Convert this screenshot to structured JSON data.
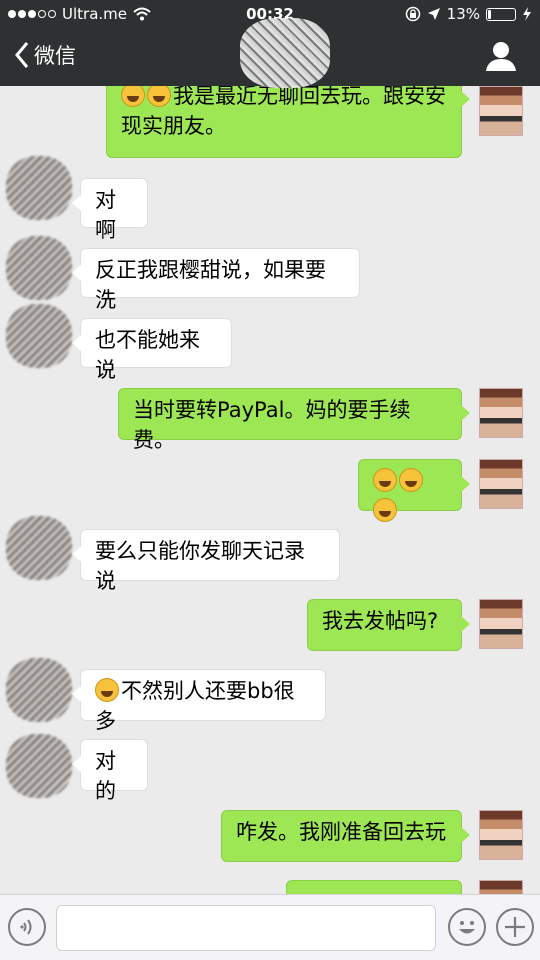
{
  "status": {
    "carrier": "Ultra.me",
    "time": "00:32",
    "battery_text": "13%",
    "battery_level": 0.13,
    "signal_dots_filled": 3,
    "signal_dots_total": 5
  },
  "nav": {
    "back_label": "微信"
  },
  "messages": [
    {
      "side": "me",
      "emoji_prefix": 2,
      "lines": [
        "我是最近无聊回去玩。跟安安",
        "现实朋友。"
      ]
    },
    {
      "side": "them",
      "lines": [
        "对啊"
      ]
    },
    {
      "side": "them",
      "lines": [
        "反正我跟樱甜说，如果要洗"
      ]
    },
    {
      "side": "them",
      "lines": [
        "也不能她来说"
      ]
    },
    {
      "side": "me",
      "lines": [
        "当时要转PayPal。妈的要手续费。"
      ]
    },
    {
      "side": "me",
      "emoji_prefix": 3,
      "lines": [
        ""
      ]
    },
    {
      "side": "them",
      "lines": [
        "要么只能你发聊天记录说"
      ]
    },
    {
      "side": "me",
      "lines": [
        "我去发帖吗?"
      ]
    },
    {
      "side": "them",
      "emoji_prefix": 1,
      "lines": [
        "不然别人还要bb很多"
      ]
    },
    {
      "side": "them",
      "lines": [
        "对的"
      ]
    },
    {
      "side": "me",
      "lines": [
        "咋发。我刚准备回去玩"
      ]
    },
    {
      "side": "me",
      "lines": [
        ""
      ]
    }
  ],
  "colors": {
    "topbar": "#2e3132",
    "me_bubble": "#9ee754",
    "them_bubble": "#ffffff",
    "chat_bg": "#ebebeb"
  },
  "icons": [
    "back-chevron-icon",
    "profile-icon",
    "voice-icon",
    "emoji-icon",
    "plus-icon",
    "wifi-icon",
    "location-icon",
    "lock-rotation-icon",
    "charging-icon"
  ]
}
